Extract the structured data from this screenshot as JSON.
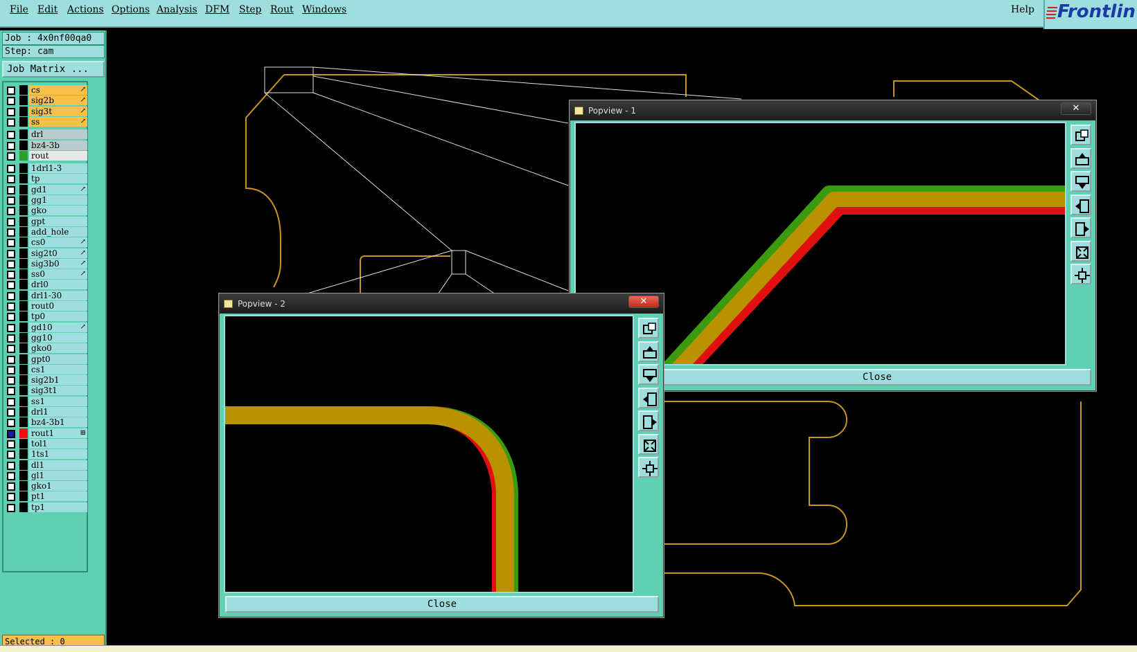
{
  "menubar": {
    "items": [
      "File",
      "Edit",
      "Actions",
      "Options",
      "Analysis",
      "DFM",
      "Step",
      "Rout",
      "Windows"
    ],
    "help": "Help",
    "brand": "Frontlin"
  },
  "left_panel": {
    "job": "Job : 4x0nf00qa0",
    "step": "Step: cam",
    "job_matrix_button": "Job Matrix ...",
    "layers": [
      {
        "name": "cs",
        "color": "#f6c04a",
        "mark": "↗"
      },
      {
        "name": "sig2b",
        "color": "#f6c04a",
        "mark": "↗"
      },
      {
        "name": "sig3t",
        "color": "#f6c04a",
        "mark": "↗"
      },
      {
        "name": "ss",
        "color": "#f6c04a",
        "mark": "↗"
      },
      {
        "name": "drl",
        "color": "#b9cccc",
        "mark": ""
      },
      {
        "name": "bz4-3b",
        "color": "#b9cccc",
        "mark": ""
      },
      {
        "name": "rout",
        "color": "#e8e8e8",
        "mark": "",
        "swatch": "#2aa02a"
      },
      {
        "name": "1drl1-3",
        "color": "#9fdede",
        "mark": ""
      },
      {
        "name": "tp",
        "color": "#9fdede",
        "mark": ""
      },
      {
        "name": "gd1",
        "color": "#9fdede",
        "mark": "↗"
      },
      {
        "name": "gg1",
        "color": "#9fdede",
        "mark": ""
      },
      {
        "name": "gko",
        "color": "#9fdede",
        "mark": ""
      },
      {
        "name": "gpt",
        "color": "#9fdede",
        "mark": ""
      },
      {
        "name": "add_hole",
        "color": "#9fdede",
        "mark": ""
      },
      {
        "name": "cs0",
        "color": "#9fdede",
        "mark": "↗"
      },
      {
        "name": "sig2t0",
        "color": "#9fdede",
        "mark": "↗"
      },
      {
        "name": "sig3b0",
        "color": "#9fdede",
        "mark": "↗"
      },
      {
        "name": "ss0",
        "color": "#9fdede",
        "mark": "↗"
      },
      {
        "name": "drl0",
        "color": "#9fdede",
        "mark": ""
      },
      {
        "name": "drl1-30",
        "color": "#9fdede",
        "mark": ""
      },
      {
        "name": "rout0",
        "color": "#9fdede",
        "mark": ""
      },
      {
        "name": "tp0",
        "color": "#9fdede",
        "mark": ""
      },
      {
        "name": "gd10",
        "color": "#9fdede",
        "mark": "↗"
      },
      {
        "name": "gg10",
        "color": "#9fdede",
        "mark": ""
      },
      {
        "name": "gko0",
        "color": "#9fdede",
        "mark": ""
      },
      {
        "name": "gpt0",
        "color": "#9fdede",
        "mark": ""
      },
      {
        "name": "cs1",
        "color": "#9fdede",
        "mark": ""
      },
      {
        "name": "sig2b1",
        "color": "#9fdede",
        "mark": ""
      },
      {
        "name": "sig3t1",
        "color": "#9fdede",
        "mark": ""
      },
      {
        "name": "ss1",
        "color": "#9fdede",
        "mark": ""
      },
      {
        "name": "drl1",
        "color": "#9fdede",
        "mark": ""
      },
      {
        "name": "bz4-3b1",
        "color": "#9fdede",
        "mark": ""
      },
      {
        "name": "rout1",
        "color": "#9fdede",
        "mark": "⊞",
        "swatch": "#e81010",
        "checked": true
      },
      {
        "name": "tol1",
        "color": "#9fdede",
        "mark": ""
      },
      {
        "name": "1ts1",
        "color": "#9fdede",
        "mark": ""
      },
      {
        "name": "dl1",
        "color": "#9fdede",
        "mark": ""
      },
      {
        "name": "gl1",
        "color": "#9fdede",
        "mark": ""
      },
      {
        "name": "gko1",
        "color": "#9fdede",
        "mark": ""
      },
      {
        "name": "pt1",
        "color": "#9fdede",
        "mark": ""
      },
      {
        "name": "tp1",
        "color": "#9fdede",
        "mark": ""
      }
    ],
    "selected": "Selected : 0"
  },
  "popview1": {
    "title": "Popview - 1",
    "close_label": "Close",
    "close_glyph": "✕"
  },
  "popview2": {
    "title": "Popview - 2",
    "close_label": "Close",
    "close_glyph": "✕"
  },
  "tool_icons": [
    "zoom-fit-icon",
    "pan-up-icon",
    "pan-down-icon",
    "pan-left-icon",
    "pan-right-icon",
    "zoom-out-icon",
    "zoom-home-icon"
  ],
  "colors": {
    "outline": "#c8961e",
    "route": "#b89200",
    "green": "#3a9a10",
    "red": "#e01010",
    "panel": "#5fd0b2",
    "menu": "#9fdede"
  }
}
